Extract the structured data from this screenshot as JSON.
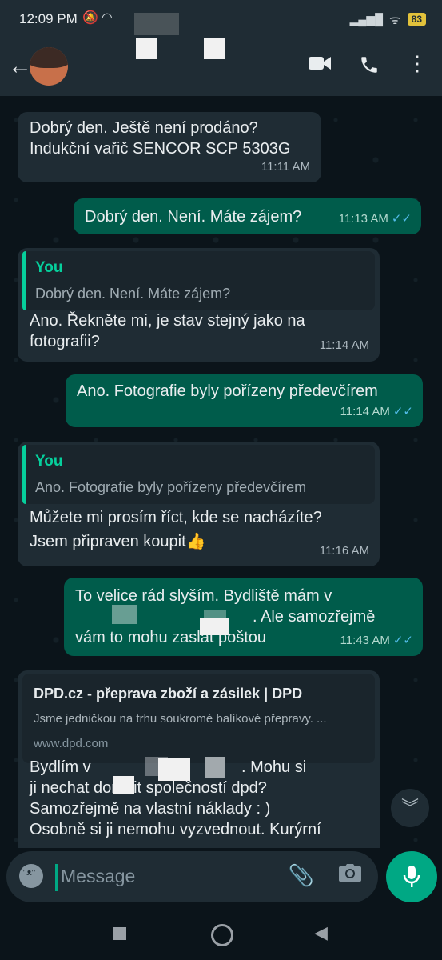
{
  "status": {
    "time": "12:09 PM",
    "battery": "83"
  },
  "chat": {
    "messages": [
      {
        "lines": [
          "Dobrý den. Ještě není prodáno?",
          "Indukční vařič SENCOR SCP 5303G"
        ],
        "time": "11:11 AM"
      },
      {
        "text": "Dobrý den. Není. Máte zájem?",
        "time": "11:13 AM"
      },
      {
        "quote_author": "You",
        "quote_text": "Dobrý den. Není. Máte zájem?",
        "lines": [
          "Ano. Řekněte mi, je stav stejný jako na",
          "fotografii?"
        ],
        "time": "11:14 AM"
      },
      {
        "text": "Ano. Fotografie byly pořízeny předevčírem",
        "time": "11:14 AM"
      },
      {
        "quote_author": "You",
        "quote_text": "Ano. Fotografie byly pořízeny předevčírem",
        "lines": [
          "Můžete mi prosím říct, kde se nacházíte?",
          "Jsem připraven koupit👍"
        ],
        "time": "11:16 AM"
      },
      {
        "lines": [
          "To velice rád slyším. Bydliště mám v",
          ". Ale samozřejmě",
          "vám to mohu zaslat poštou"
        ],
        "time": "11:43 AM"
      },
      {
        "link_title": "DPD.cz - přeprava zboží a zásilek | DPD",
        "link_desc": "Jsme jedničkou na trhu soukromé balíkové přepravy. ...",
        "link_url": "www.dpd.com",
        "lines": [
          "Bydlím v",
          ". Mohu si",
          "ji nechat doručit společností dpd?",
          "Samozřejmě na vlastní náklady : )",
          "Osobně si ji nemohu vyzvednout.  Kurýrní"
        ]
      }
    ]
  },
  "input": {
    "placeholder": "Message"
  },
  "colors": {
    "incoming": "#1f2c34",
    "outgoing": "#005c4b",
    "accent": "#00a884",
    "read_ticks": "#53bdeb"
  },
  "icons": [
    "back-arrow-icon",
    "video-call-icon",
    "phone-icon",
    "more-vert-icon",
    "emoji-icon",
    "attach-icon",
    "camera-icon",
    "mic-icon",
    "scroll-down-icon"
  ]
}
